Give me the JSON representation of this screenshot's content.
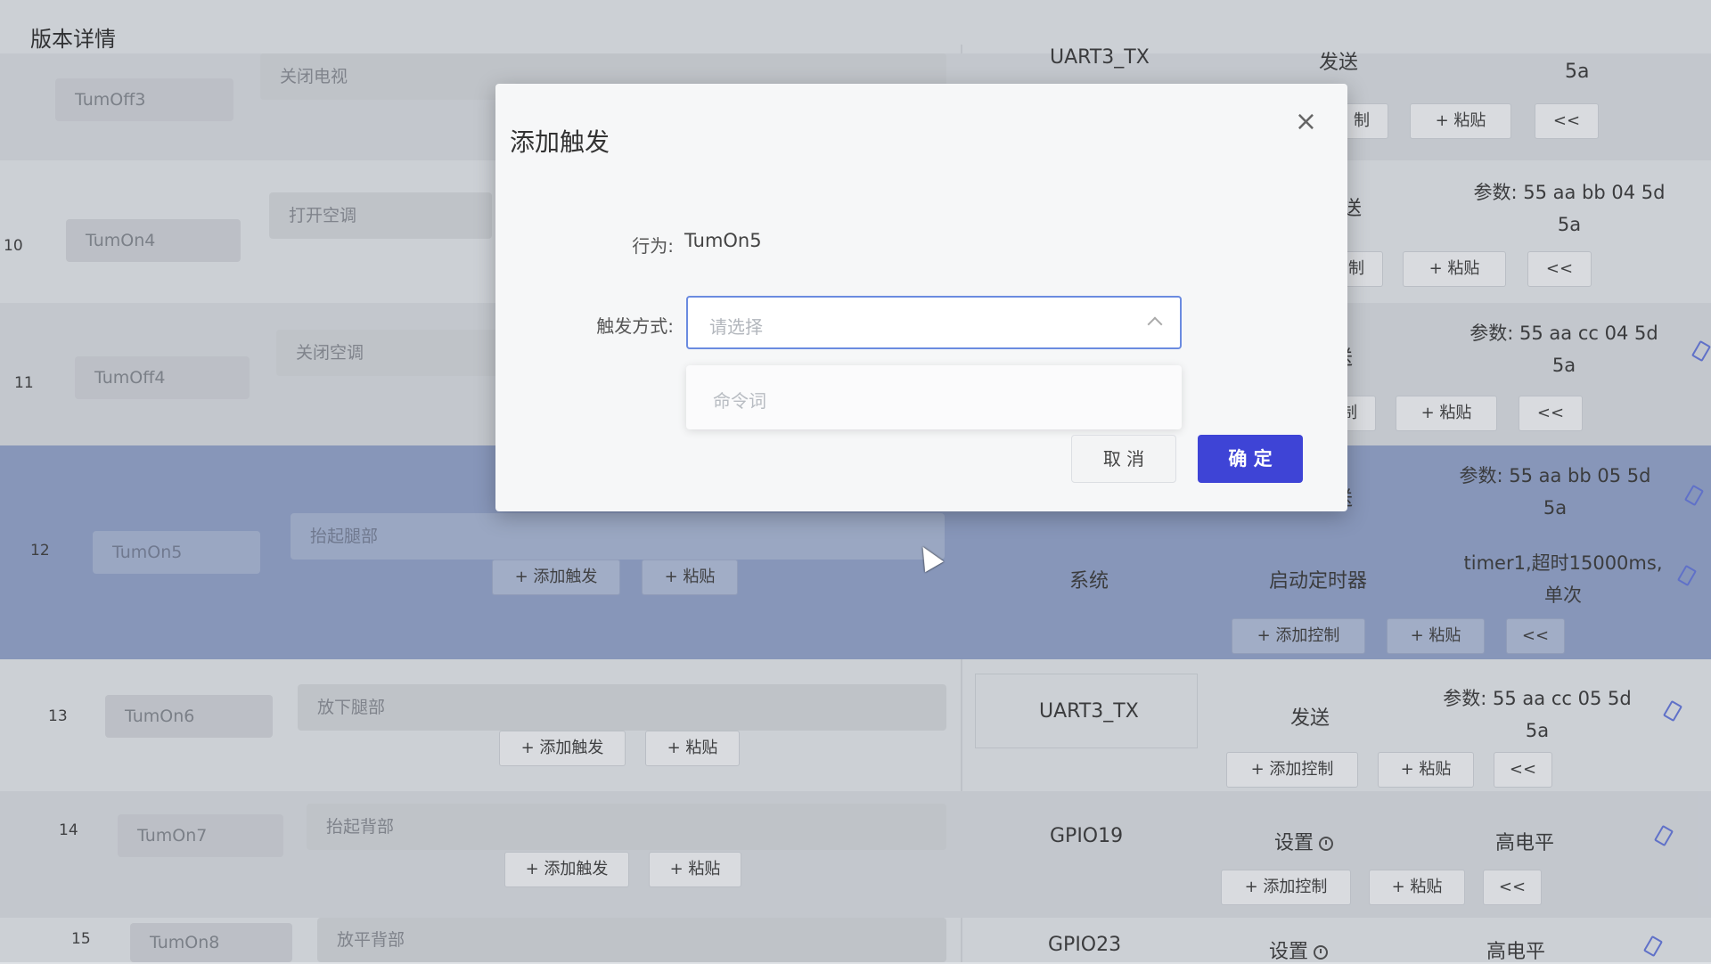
{
  "page": {
    "title": "版本详情"
  },
  "rows": [
    {
      "num": "",
      "trigger": "TumOff3",
      "behavior": "关闭电视"
    },
    {
      "num": "10",
      "trigger": "TumOn4",
      "behavior": "打开空调"
    },
    {
      "num": "11",
      "trigger": "TumOff4",
      "behavior": "关闭空调"
    },
    {
      "num": "12",
      "trigger": "TumOn5",
      "behavior": "抬起腿部"
    },
    {
      "num": "13",
      "trigger": "TumOn6",
      "behavior": "放下腿部"
    },
    {
      "num": "14",
      "trigger": "TumOn7",
      "behavior": "抬起背部"
    },
    {
      "num": "15",
      "trigger": "TumOn8",
      "behavior": "放平背部"
    }
  ],
  "buttons": {
    "add_trigger": "+ 添加触发",
    "paste": "+ 粘贴",
    "add_control": "+ 添加控制",
    "collapse": "<<",
    "control_partial": "制"
  },
  "controls": {
    "r0": {
      "target": "UART3_TX",
      "action": "发送",
      "param": "5a"
    },
    "r1": {
      "action": "送",
      "param_line1": "参数: 55 aa bb 04 5d",
      "param_line2": "5a"
    },
    "r2": {
      "action": "送",
      "param_line1": "参数: 55 aa cc 04 5d",
      "param_line2": "5a"
    },
    "r3a": {
      "action": "送",
      "param_line1": "参数: 55 aa bb 05 5d",
      "param_line2": "5a"
    },
    "r3b": {
      "target": "系统",
      "action": "启动定时器",
      "param_line1": "timer1,超时15000ms,",
      "param_line2": "单次"
    },
    "r4": {
      "target": "UART3_TX",
      "action": "发送",
      "param_line1": "参数: 55 aa cc 05 5d",
      "param_line2": "5a"
    },
    "r5": {
      "target": "GPIO19",
      "action": "设置",
      "param": "高电平"
    },
    "r6": {
      "target": "GPIO23",
      "action": "设置",
      "param": "高电平"
    }
  },
  "modal": {
    "title": "添加触发",
    "close": "×",
    "behavior_label": "行为:",
    "behavior_value": "TumOn5",
    "trigger_label": "触发方式:",
    "select_placeholder": "请选择",
    "dropdown_option": "命令词",
    "cancel": "取 消",
    "confirm": "确 定"
  }
}
